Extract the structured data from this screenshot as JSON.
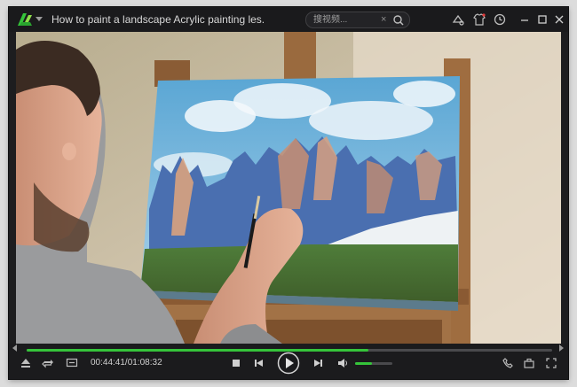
{
  "app": {
    "title": "How to paint a landscape  Acrylic painting les...",
    "brand_color": "#35c43a"
  },
  "search": {
    "placeholder": "搜视频...",
    "value": ""
  },
  "icons": {
    "logo": "player-logo-icon",
    "skin": "skin-icon",
    "shirt": "theme-shirt-icon",
    "history": "clock-history-icon",
    "minimize": "minimize-icon",
    "maximize": "maximize-icon",
    "close": "close-icon"
  },
  "playback": {
    "current_time": "00:44:41",
    "total_time": "01:08:32",
    "time_display": "00:44:41/01:08:32",
    "progress_fraction": 0.65,
    "volume_fraction": 0.45,
    "state": "paused"
  },
  "colors": {
    "accent": "#35c43a",
    "window_bg": "#1d1d1f",
    "text": "#d8d8d8"
  }
}
